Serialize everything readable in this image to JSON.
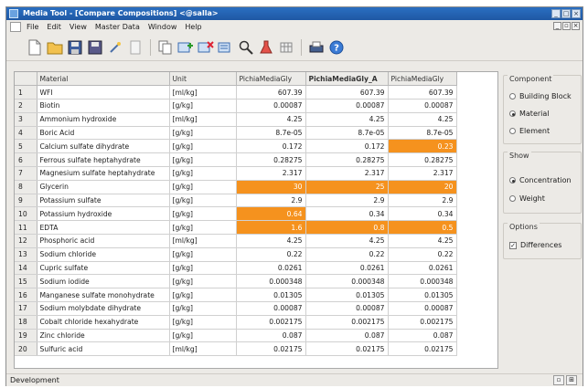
{
  "window": {
    "title": "Media Tool - [Compare Compositions] <@salla>"
  },
  "menu": [
    "File",
    "Edit",
    "View",
    "Master Data",
    "Window",
    "Help"
  ],
  "toolbar_icons": [
    "new-file-icon",
    "open-folder-icon",
    "save-icon",
    "save-as-icon",
    "wizard-icon",
    "page-icon",
    "copy-icon",
    "add-row-icon",
    "delete-row-icon",
    "compare-icon",
    "search-icon",
    "flask-icon",
    "table-icon",
    "print-icon",
    "help-icon"
  ],
  "table": {
    "headers": [
      "Material",
      "Unit",
      "PichiaMediaGly",
      "PichiaMediaGly_A",
      "PichiaMediaGly"
    ],
    "rows": [
      {
        "n": "1",
        "material": "WFI",
        "unit": "[ml/kg]",
        "v1": "607.39",
        "v2": "607.39",
        "v3": "607.39",
        "hl": [
          false,
          false,
          false
        ]
      },
      {
        "n": "2",
        "material": "Biotin",
        "unit": "[g/kg]",
        "v1": "0.00087",
        "v2": "0.00087",
        "v3": "0.00087",
        "hl": [
          false,
          false,
          false
        ]
      },
      {
        "n": "3",
        "material": "Ammonium hydroxide",
        "unit": "[ml/kg]",
        "v1": "4.25",
        "v2": "4.25",
        "v3": "4.25",
        "hl": [
          false,
          false,
          false
        ]
      },
      {
        "n": "4",
        "material": "Boric Acid",
        "unit": "[g/kg]",
        "v1": "8.7e-05",
        "v2": "8.7e-05",
        "v3": "8.7e-05",
        "hl": [
          false,
          false,
          false
        ]
      },
      {
        "n": "5",
        "material": "Calcium sulfate dihydrate",
        "unit": "[g/kg]",
        "v1": "0.172",
        "v2": "0.172",
        "v3": "0.23",
        "hl": [
          false,
          false,
          true
        ]
      },
      {
        "n": "6",
        "material": "Ferrous sulfate heptahydrate",
        "unit": "[g/kg]",
        "v1": "0.28275",
        "v2": "0.28275",
        "v3": "0.28275",
        "hl": [
          false,
          false,
          false
        ]
      },
      {
        "n": "7",
        "material": "Magnesium sulfate heptahydrate",
        "unit": "[g/kg]",
        "v1": "2.317",
        "v2": "2.317",
        "v3": "2.317",
        "hl": [
          false,
          false,
          false
        ]
      },
      {
        "n": "8",
        "material": "Glycerin",
        "unit": "[g/kg]",
        "v1": "30",
        "v2": "25",
        "v3": "20",
        "hl": [
          true,
          true,
          true
        ]
      },
      {
        "n": "9",
        "material": "Potassium sulfate",
        "unit": "[g/kg]",
        "v1": "2.9",
        "v2": "2.9",
        "v3": "2.9",
        "hl": [
          false,
          false,
          false
        ]
      },
      {
        "n": "10",
        "material": "Potassium hydroxide",
        "unit": "[g/kg]",
        "v1": "0.64",
        "v2": "0.34",
        "v3": "0.34",
        "hl": [
          true,
          false,
          false
        ]
      },
      {
        "n": "11",
        "material": "EDTA",
        "unit": "[g/kg]",
        "v1": "1.6",
        "v2": "0.8",
        "v3": "0.5",
        "hl": [
          true,
          true,
          true
        ]
      },
      {
        "n": "12",
        "material": "Phosphoric acid",
        "unit": "[ml/kg]",
        "v1": "4.25",
        "v2": "4.25",
        "v3": "4.25",
        "hl": [
          false,
          false,
          false
        ]
      },
      {
        "n": "13",
        "material": "Sodium chloride",
        "unit": "[g/kg]",
        "v1": "0.22",
        "v2": "0.22",
        "v3": "0.22",
        "hl": [
          false,
          false,
          false
        ]
      },
      {
        "n": "14",
        "material": "Cupric sulfate",
        "unit": "[g/kg]",
        "v1": "0.0261",
        "v2": "0.0261",
        "v3": "0.0261",
        "hl": [
          false,
          false,
          false
        ]
      },
      {
        "n": "15",
        "material": "Sodium iodide",
        "unit": "[g/kg]",
        "v1": "0.000348",
        "v2": "0.000348",
        "v3": "0.000348",
        "hl": [
          false,
          false,
          false
        ]
      },
      {
        "n": "16",
        "material": "Manganese sulfate monohydrate",
        "unit": "[g/kg]",
        "v1": "0.01305",
        "v2": "0.01305",
        "v3": "0.01305",
        "hl": [
          false,
          false,
          false
        ]
      },
      {
        "n": "17",
        "material": "Sodium molybdate dihydrate",
        "unit": "[g/kg]",
        "v1": "0.00087",
        "v2": "0.00087",
        "v3": "0.00087",
        "hl": [
          false,
          false,
          false
        ]
      },
      {
        "n": "18",
        "material": "Cobalt chloride hexahydrate",
        "unit": "[g/kg]",
        "v1": "0.002175",
        "v2": "0.002175",
        "v3": "0.002175",
        "hl": [
          false,
          false,
          false
        ]
      },
      {
        "n": "19",
        "material": "Zinc chloride",
        "unit": "[g/kg]",
        "v1": "0.087",
        "v2": "0.087",
        "v3": "0.087",
        "hl": [
          false,
          false,
          false
        ]
      },
      {
        "n": "20",
        "material": "Sulfuric acid",
        "unit": "[ml/kg]",
        "v1": "0.02175",
        "v2": "0.02175",
        "v3": "0.02175",
        "hl": [
          false,
          false,
          false
        ]
      }
    ]
  },
  "side": {
    "component": {
      "title": "Component",
      "options": [
        {
          "label": "Building Block",
          "selected": false
        },
        {
          "label": "Material",
          "selected": true
        },
        {
          "label": "Element",
          "selected": false
        }
      ]
    },
    "show": {
      "title": "Show",
      "options": [
        {
          "label": "Concentration",
          "selected": true
        },
        {
          "label": "Weight",
          "selected": false
        }
      ]
    },
    "options": {
      "title": "Options",
      "differences_label": "Differences",
      "differences_checked": true
    }
  },
  "status": {
    "text": "Development"
  },
  "colors": {
    "highlight": "#f5921e",
    "titlebar": "#2a6fc1"
  }
}
